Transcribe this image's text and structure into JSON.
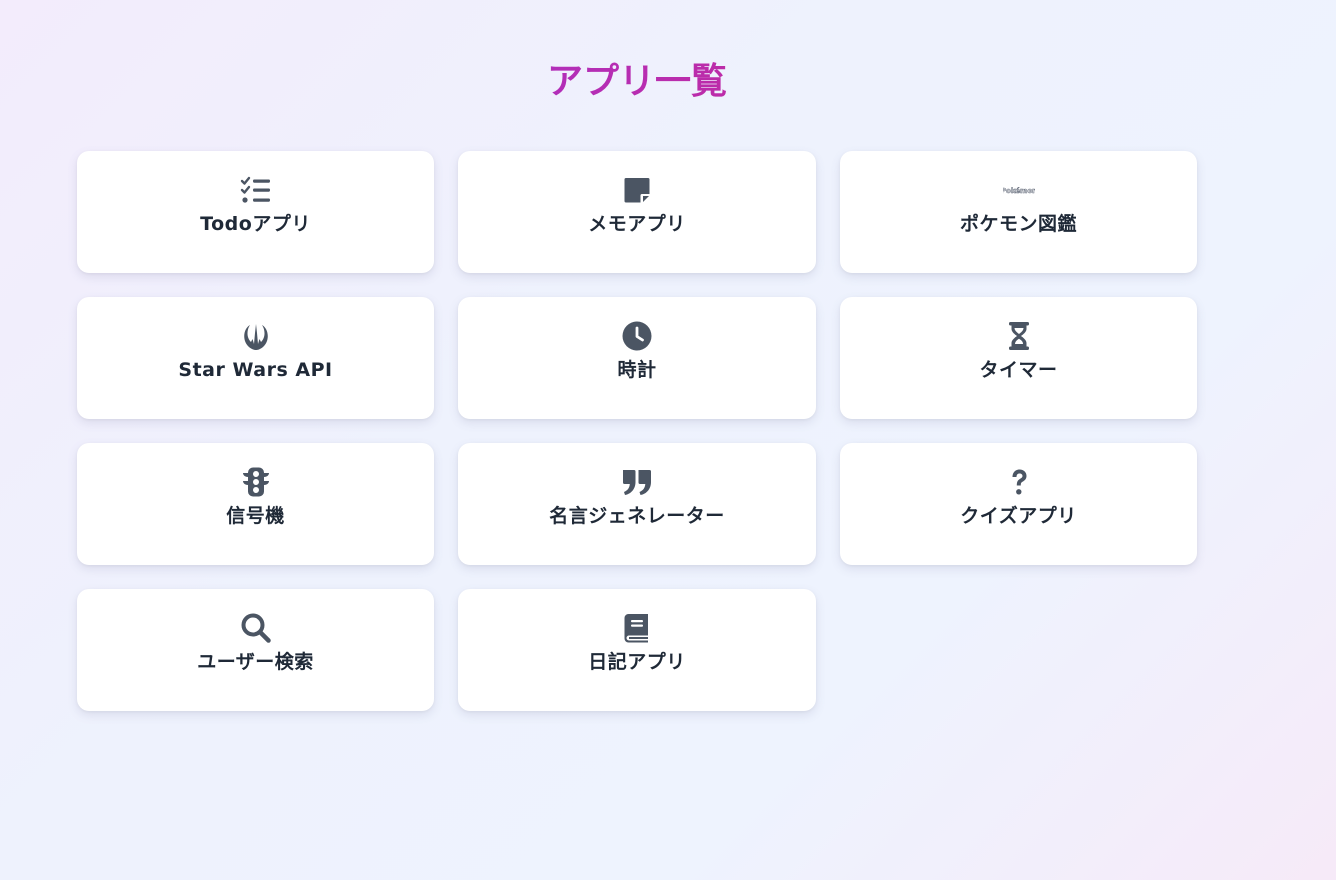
{
  "page": {
    "title": "アプリ一覧"
  },
  "apps": [
    {
      "label": "Todoアプリ",
      "icon": "checklist-icon"
    },
    {
      "label": "メモアプリ",
      "icon": "sticky-note-icon"
    },
    {
      "label": "ポケモン図鑑",
      "icon": "pokemon-logo-icon",
      "logo_text": "Pokémon"
    },
    {
      "label": "Star Wars API",
      "icon": "jedi-order-icon"
    },
    {
      "label": "時計",
      "icon": "clock-icon"
    },
    {
      "label": "タイマー",
      "icon": "hourglass-icon"
    },
    {
      "label": "信号機",
      "icon": "traffic-light-icon"
    },
    {
      "label": "名言ジェネレーター",
      "icon": "quote-icon"
    },
    {
      "label": "クイズアプリ",
      "icon": "question-icon"
    },
    {
      "label": "ユーザー検索",
      "icon": "search-icon"
    },
    {
      "label": "日記アプリ",
      "icon": "book-icon"
    }
  ],
  "colors": {
    "icon": "#4b5563",
    "label": "#1f2937",
    "title_gradient_start": "#9333ea",
    "title_gradient_end": "#db2777",
    "card_background": "#ffffff"
  }
}
